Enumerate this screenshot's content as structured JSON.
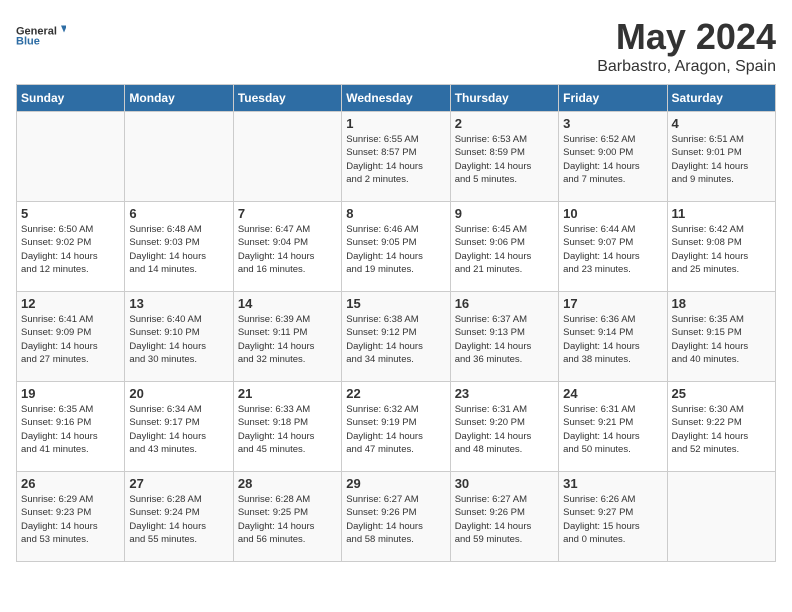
{
  "logo": {
    "general": "General",
    "blue": "Blue"
  },
  "title": "May 2024",
  "location": "Barbastro, Aragon, Spain",
  "weekdays": [
    "Sunday",
    "Monday",
    "Tuesday",
    "Wednesday",
    "Thursday",
    "Friday",
    "Saturday"
  ],
  "weeks": [
    [
      {
        "day": "",
        "info": ""
      },
      {
        "day": "",
        "info": ""
      },
      {
        "day": "",
        "info": ""
      },
      {
        "day": "1",
        "info": "Sunrise: 6:55 AM\nSunset: 8:57 PM\nDaylight: 14 hours\nand 2 minutes."
      },
      {
        "day": "2",
        "info": "Sunrise: 6:53 AM\nSunset: 8:59 PM\nDaylight: 14 hours\nand 5 minutes."
      },
      {
        "day": "3",
        "info": "Sunrise: 6:52 AM\nSunset: 9:00 PM\nDaylight: 14 hours\nand 7 minutes."
      },
      {
        "day": "4",
        "info": "Sunrise: 6:51 AM\nSunset: 9:01 PM\nDaylight: 14 hours\nand 9 minutes."
      }
    ],
    [
      {
        "day": "5",
        "info": "Sunrise: 6:50 AM\nSunset: 9:02 PM\nDaylight: 14 hours\nand 12 minutes."
      },
      {
        "day": "6",
        "info": "Sunrise: 6:48 AM\nSunset: 9:03 PM\nDaylight: 14 hours\nand 14 minutes."
      },
      {
        "day": "7",
        "info": "Sunrise: 6:47 AM\nSunset: 9:04 PM\nDaylight: 14 hours\nand 16 minutes."
      },
      {
        "day": "8",
        "info": "Sunrise: 6:46 AM\nSunset: 9:05 PM\nDaylight: 14 hours\nand 19 minutes."
      },
      {
        "day": "9",
        "info": "Sunrise: 6:45 AM\nSunset: 9:06 PM\nDaylight: 14 hours\nand 21 minutes."
      },
      {
        "day": "10",
        "info": "Sunrise: 6:44 AM\nSunset: 9:07 PM\nDaylight: 14 hours\nand 23 minutes."
      },
      {
        "day": "11",
        "info": "Sunrise: 6:42 AM\nSunset: 9:08 PM\nDaylight: 14 hours\nand 25 minutes."
      }
    ],
    [
      {
        "day": "12",
        "info": "Sunrise: 6:41 AM\nSunset: 9:09 PM\nDaylight: 14 hours\nand 27 minutes."
      },
      {
        "day": "13",
        "info": "Sunrise: 6:40 AM\nSunset: 9:10 PM\nDaylight: 14 hours\nand 30 minutes."
      },
      {
        "day": "14",
        "info": "Sunrise: 6:39 AM\nSunset: 9:11 PM\nDaylight: 14 hours\nand 32 minutes."
      },
      {
        "day": "15",
        "info": "Sunrise: 6:38 AM\nSunset: 9:12 PM\nDaylight: 14 hours\nand 34 minutes."
      },
      {
        "day": "16",
        "info": "Sunrise: 6:37 AM\nSunset: 9:13 PM\nDaylight: 14 hours\nand 36 minutes."
      },
      {
        "day": "17",
        "info": "Sunrise: 6:36 AM\nSunset: 9:14 PM\nDaylight: 14 hours\nand 38 minutes."
      },
      {
        "day": "18",
        "info": "Sunrise: 6:35 AM\nSunset: 9:15 PM\nDaylight: 14 hours\nand 40 minutes."
      }
    ],
    [
      {
        "day": "19",
        "info": "Sunrise: 6:35 AM\nSunset: 9:16 PM\nDaylight: 14 hours\nand 41 minutes."
      },
      {
        "day": "20",
        "info": "Sunrise: 6:34 AM\nSunset: 9:17 PM\nDaylight: 14 hours\nand 43 minutes."
      },
      {
        "day": "21",
        "info": "Sunrise: 6:33 AM\nSunset: 9:18 PM\nDaylight: 14 hours\nand 45 minutes."
      },
      {
        "day": "22",
        "info": "Sunrise: 6:32 AM\nSunset: 9:19 PM\nDaylight: 14 hours\nand 47 minutes."
      },
      {
        "day": "23",
        "info": "Sunrise: 6:31 AM\nSunset: 9:20 PM\nDaylight: 14 hours\nand 48 minutes."
      },
      {
        "day": "24",
        "info": "Sunrise: 6:31 AM\nSunset: 9:21 PM\nDaylight: 14 hours\nand 50 minutes."
      },
      {
        "day": "25",
        "info": "Sunrise: 6:30 AM\nSunset: 9:22 PM\nDaylight: 14 hours\nand 52 minutes."
      }
    ],
    [
      {
        "day": "26",
        "info": "Sunrise: 6:29 AM\nSunset: 9:23 PM\nDaylight: 14 hours\nand 53 minutes."
      },
      {
        "day": "27",
        "info": "Sunrise: 6:28 AM\nSunset: 9:24 PM\nDaylight: 14 hours\nand 55 minutes."
      },
      {
        "day": "28",
        "info": "Sunrise: 6:28 AM\nSunset: 9:25 PM\nDaylight: 14 hours\nand 56 minutes."
      },
      {
        "day": "29",
        "info": "Sunrise: 6:27 AM\nSunset: 9:26 PM\nDaylight: 14 hours\nand 58 minutes."
      },
      {
        "day": "30",
        "info": "Sunrise: 6:27 AM\nSunset: 9:26 PM\nDaylight: 14 hours\nand 59 minutes."
      },
      {
        "day": "31",
        "info": "Sunrise: 6:26 AM\nSunset: 9:27 PM\nDaylight: 15 hours\nand 0 minutes."
      },
      {
        "day": "",
        "info": ""
      }
    ]
  ]
}
